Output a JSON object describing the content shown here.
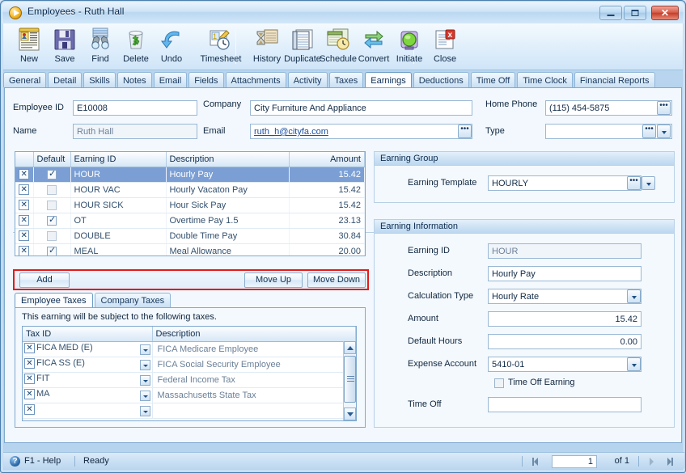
{
  "window": {
    "title": "Employees - Ruth Hall",
    "icon": "play-circle-icon",
    "minimize_label": "–",
    "maximize_label": "□",
    "close_label": "✕"
  },
  "toolbar": {
    "items": [
      {
        "label": "New",
        "icon": "new-document-icon"
      },
      {
        "label": "Save",
        "icon": "floppy-disk-icon"
      },
      {
        "label": "Find",
        "icon": "binoculars-icon"
      },
      {
        "label": "Delete",
        "icon": "trash-recycle-icon"
      },
      {
        "label": "Undo",
        "icon": "undo-arrow-icon"
      },
      {
        "label": "Timesheet",
        "icon": "timesheet-clock-icon"
      },
      {
        "label": "History",
        "icon": "hourglass-history-icon"
      },
      {
        "label": "Duplicate",
        "icon": "duplicate-pages-icon"
      },
      {
        "label": "Schedule",
        "icon": "schedule-calendar-icon"
      },
      {
        "label": "Convert",
        "icon": "convert-arrows-icon"
      },
      {
        "label": "Initiate",
        "icon": "initiate-light-icon"
      },
      {
        "label": "Close",
        "icon": "close-document-icon"
      }
    ]
  },
  "tabs": [
    {
      "label": "General",
      "active": false
    },
    {
      "label": "Detail",
      "active": false
    },
    {
      "label": "Skills",
      "active": false
    },
    {
      "label": "Notes",
      "active": false
    },
    {
      "label": "Email",
      "active": false
    },
    {
      "label": "Fields",
      "active": false
    },
    {
      "label": "Attachments",
      "active": false
    },
    {
      "label": "Activity",
      "active": false
    },
    {
      "label": "Taxes",
      "active": false
    },
    {
      "label": "Earnings",
      "active": true
    },
    {
      "label": "Deductions",
      "active": false
    },
    {
      "label": "Time Off",
      "active": false
    },
    {
      "label": "Time Clock",
      "active": false
    },
    {
      "label": "Financial Reports",
      "active": false
    }
  ],
  "header": {
    "employee_id_label": "Employee ID",
    "employee_id_value": "E10008",
    "name_label": "Name",
    "name_value": "Ruth Hall",
    "company_label": "Company",
    "company_value": "City Furniture And Appliance",
    "email_label": "Email",
    "email_value": "ruth_h@cityfa.com",
    "home_phone_label": "Home Phone",
    "home_phone_value": "(115) 454-5875",
    "type_label": "Type",
    "type_value": "",
    "ellipsis_glyph": "•••"
  },
  "earnings_grid": {
    "columns": [
      "",
      "Default",
      "Earning ID",
      "Description",
      "Amount"
    ],
    "delete_glyph": "✕",
    "rows": [
      {
        "default": true,
        "earning_id": "HOUR",
        "description": "Hourly Pay",
        "amount": "15.42",
        "selected": true
      },
      {
        "default": false,
        "earning_id": "HOUR VAC",
        "description": "Hourly Vacaton Pay",
        "amount": "15.42",
        "selected": false
      },
      {
        "default": false,
        "earning_id": "HOUR SICK",
        "description": "Hour Sick Pay",
        "amount": "15.42",
        "selected": false
      },
      {
        "default": true,
        "earning_id": "OT",
        "description": "Overtime Pay 1.5",
        "amount": "23.13",
        "selected": false
      },
      {
        "default": false,
        "earning_id": "DOUBLE",
        "description": "Double Time Pay",
        "amount": "30.84",
        "selected": false
      },
      {
        "default": true,
        "earning_id": "MEAL",
        "description": "Meal Allowance",
        "amount": "20.00",
        "selected": false
      }
    ]
  },
  "action_bar": {
    "add_label": "Add",
    "move_up_label": "Move Up",
    "move_down_label": "Move Down",
    "highlight_color": "#e51a1a"
  },
  "tax_section": {
    "tabs": [
      {
        "label": "Employee Taxes",
        "active": true
      },
      {
        "label": "Company Taxes",
        "active": false
      }
    ],
    "note": "This earning will be subject to the following taxes.",
    "columns": [
      "Tax ID",
      "Description"
    ],
    "delete_glyph": "✕",
    "rows": [
      {
        "tax_id": "FICA MED (E)",
        "description": "FICA Medicare Employee"
      },
      {
        "tax_id": "FICA SS (E)",
        "description": "FICA Social Security Employee"
      },
      {
        "tax_id": "FIT",
        "description": "Federal Income Tax"
      },
      {
        "tax_id": "MA",
        "description": "Massachusetts State Tax"
      },
      {
        "tax_id": "",
        "description": ""
      }
    ]
  },
  "earning_group": {
    "title": "Earning Group",
    "template_label": "Earning Template",
    "template_value": "HOURLY"
  },
  "earning_information": {
    "title": "Earning Information",
    "earning_id_label": "Earning ID",
    "earning_id_value": "HOUR",
    "description_label": "Description",
    "description_value": "Hourly Pay",
    "calculation_type_label": "Calculation Type",
    "calculation_type_value": "Hourly Rate",
    "amount_label": "Amount",
    "amount_value": "15.42",
    "default_hours_label": "Default Hours",
    "default_hours_value": "0.00",
    "expense_account_label": "Expense Account",
    "expense_account_value": "5410-01",
    "time_off_earning_label": "Time Off Earning",
    "time_off_earning_checked": false,
    "time_off_label": "Time Off",
    "time_off_value": ""
  },
  "status_bar": {
    "help_icon": "question-mark-icon",
    "help_label": "F1 - Help",
    "ready_label": "Ready",
    "record_value": "1",
    "of_label": "of 1",
    "first_icon": "first-record-icon",
    "prev_icon": "previous-record-icon",
    "next_icon": "next-record-icon",
    "last_icon": "last-record-icon"
  }
}
